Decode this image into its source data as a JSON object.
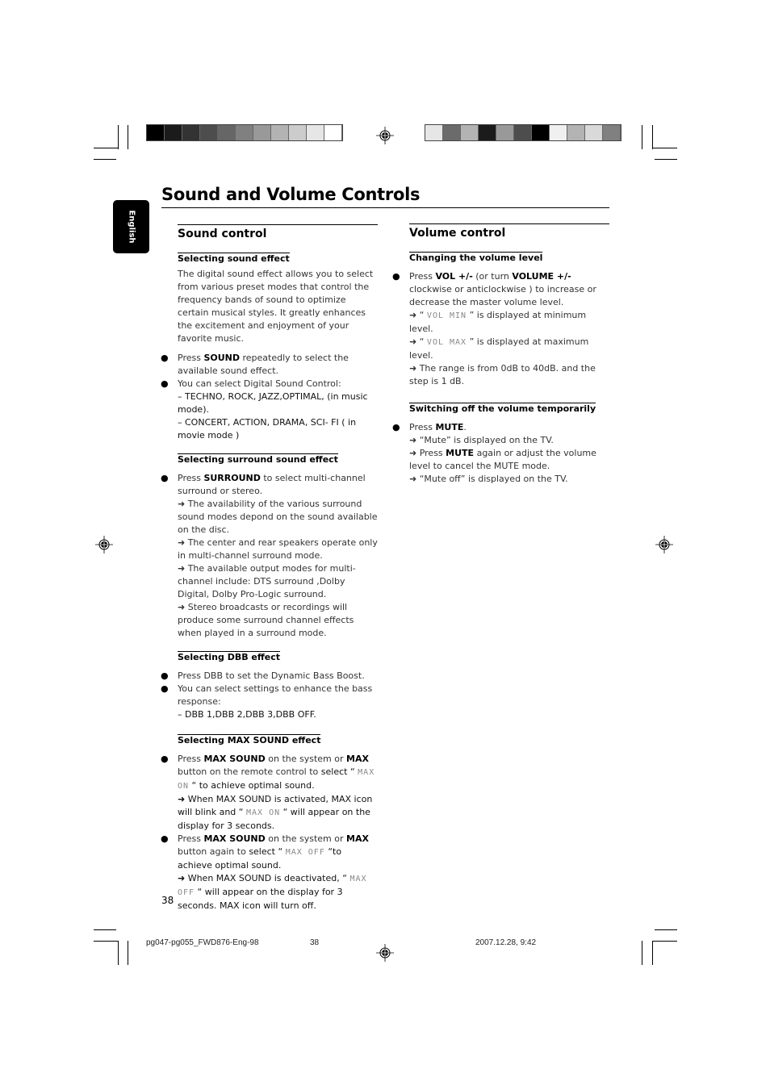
{
  "page": {
    "title": "Sound and Volume Controls",
    "language_tab": "English",
    "page_number": "38"
  },
  "color_bars": {
    "left": [
      "#000000",
      "#1b1b1b",
      "#333333",
      "#4d4d4d",
      "#666666",
      "#808080",
      "#999999",
      "#b3b3b3",
      "#cccccc",
      "#e6e6e6",
      "#ffffff"
    ],
    "right": [
      "#e6e6e6",
      "#6b6b6b",
      "#b3b3b3",
      "#1b1b1b",
      "#999999",
      "#4d4d4d",
      "#000000",
      "#f0f0f0",
      "#b3b3b3",
      "#d9d9d9",
      "#808080"
    ]
  },
  "sound_control": {
    "heading": "Sound control",
    "selecting_sound_effect": {
      "title": "Selecting sound effect",
      "intro": "The digital sound effect allows you to select from various preset modes that control the frequency bands of sound to optimize certain musical styles. It greatly enhances the excitement and enjoyment of your favorite music.",
      "b1_pre": "Press ",
      "b1_key": "SOUND",
      "b1_post": " repeatedly to select the available sound effect.",
      "b2": "You can select Digital Sound Control:",
      "b2_opt1": "–  TECHNO, ROCK, JAZZ,OPTIMAL, (in music mode).",
      "b2_opt2": "–  CONCERT, ACTION, DRAMA, SCI- FI ( in movie mode )"
    },
    "selecting_surround": {
      "title": "Selecting surround  sound  effect",
      "b1_pre": "Press ",
      "b1_key": "SURROUND",
      "b1_post": " to select multi-channel surround or stereo.",
      "r1": "➜ The availability of the various surround sound modes depond on the sound available on the disc.",
      "r2": "➜ The center and rear speakers operate only in multi-channel surround mode.",
      "r3": "➜ The available output modes for multi-channel include: DTS surround ,Dolby Digital, Dolby Pro-Logic surround.",
      "r4": "➜ Stereo broadcasts or recordings will produce some surround channel effects when played in a surround mode."
    },
    "selecting_dbb": {
      "title": "Selecting DBB effect",
      "b1": "Press DBB to set the Dynamic Bass Boost.",
      "b2": "You can select settings to enhance the bass response:",
      "b2_opt": "–  DBB 1,DBB 2,DBB 3,DBB OFF."
    },
    "selecting_max": {
      "title": "Selecting MAX SOUND effect",
      "b1_pre": "Press ",
      "b1_key": "MAX SOUND",
      "b1_mid": " on the system or ",
      "b1_key2": "MAX",
      "b1_mid2": " button on the remote control to ",
      "b1_select": "select",
      "b1_q1": " “ ",
      "b1_lcd": "MAX ON",
      "b1_end": " “ to achieve optimal sound.",
      "r1_pre": "➜ When MAX SOUND is activated, MAX icon will blink and “ ",
      "r1_lcd": "MAX ON",
      "r1_post": " “ will appear  on the display for 3 seconds.",
      "b2_pre": "Press ",
      "b2_key": "MAX SOUND",
      "b2_mid": " on the system or ",
      "b2_key2": "MAX",
      "b2_mid2": " button again to ",
      "b2_select": "select",
      "b2_q1": " “ ",
      "b2_lcd": "MAX OFF",
      "b2_end": " “to achieve optimal sound.",
      "r2_pre": "➜ When MAX SOUND is deactivated, “ ",
      "r2_lcd": "MAX OFF",
      "r2_post": " “ will appear on the display for 3 seconds. MAX icon will turn off."
    }
  },
  "volume_control": {
    "heading": "Volume control",
    "changing_level": {
      "title": "Changing the volume level",
      "b1_pre": "Press ",
      "b1_key": "VOL +/-",
      "b1_mid": "  (or turn  ",
      "b1_key2": "VOLUME +/-",
      "b1_post": " clockwise or anticlockwise ) to increase or decrease the master volume level.",
      "r1_pre": "➜ “ ",
      "r1_lcd": "VOL MIN",
      "r1_post": " ” is displayed at minimum level.",
      "r2_pre": "➜ “ ",
      "r2_lcd": "VOL MAX",
      "r2_post": " ” is displayed at maximum level.",
      "r3": "➜ The range is from 0dB to 40dB. and the step is 1 dB."
    },
    "mute": {
      "title": "Switching off the volume temporarily",
      "b1_pre": "Press ",
      "b1_key": "MUTE",
      "b1_post": ".",
      "r1": "➜ “Mute” is displayed on the  TV.",
      "r2_pre": "➜ Press ",
      "r2_key": "MUTE",
      "r2_post": " again or adjust the volume level to cancel the MUTE mode.",
      "r3": "➜ “Mute off” is displayed on the  TV."
    }
  },
  "footer": {
    "file": "pg047-pg055_FWD876-Eng-98",
    "page": "38",
    "timestamp": "2007.12.28, 9:42"
  }
}
